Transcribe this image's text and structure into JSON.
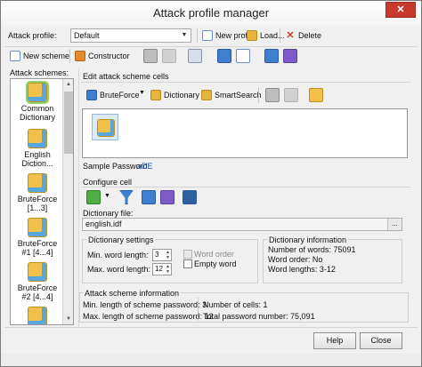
{
  "window": {
    "title": "Attack profile manager",
    "close_glyph": "✕"
  },
  "toolbar1": {
    "attack_profile_label": "Attack profile:",
    "profile_value": "Default",
    "new_profile": "New profile",
    "load": "Load...",
    "delete": "Delete"
  },
  "toolbar2": {
    "new_scheme": "New scheme",
    "constructor": "Constructor"
  },
  "schemes": {
    "title": "Attack schemes:",
    "items": [
      {
        "label": "Common Dictionary"
      },
      {
        "label": "English Diction..."
      },
      {
        "label": "BruteForce [1...3]"
      },
      {
        "label": "BruteForce #1 [4...4]"
      },
      {
        "label": "BruteForce #2 [4...4]"
      },
      {
        "label": ""
      }
    ]
  },
  "edit_cells": {
    "title": "Edit attack scheme cells",
    "bruteforce": "BruteForce",
    "dictionary": "Dictionary",
    "smartsearch": "SmartSearch"
  },
  "sample": {
    "label": "Sample Password:",
    "value": "aDE"
  },
  "configure": {
    "title": "Configure cell"
  },
  "dict_file": {
    "label": "Dictionary file:",
    "value": "english.idf",
    "browse": "..."
  },
  "dict_settings": {
    "title": "Dictionary settings",
    "min_label": "Min. word length:",
    "min_value": "3",
    "max_label": "Max. word length:",
    "max_value": "12",
    "word_order": "Word order",
    "empty_word": "Empty word"
  },
  "dict_info": {
    "title": "Dictionary information",
    "words": "Number of words: 75091",
    "order": "Word order: No",
    "lengths": "Word lengths: 3-12"
  },
  "scheme_info": {
    "title": "Attack scheme information",
    "min_len": "Min. length of scheme password: 3",
    "max_len": "Max. length of scheme password: 12",
    "cells": "Number of cells: 1",
    "total": "Total password number: 75,091"
  },
  "buttons": {
    "help": "Help",
    "close": "Close"
  }
}
